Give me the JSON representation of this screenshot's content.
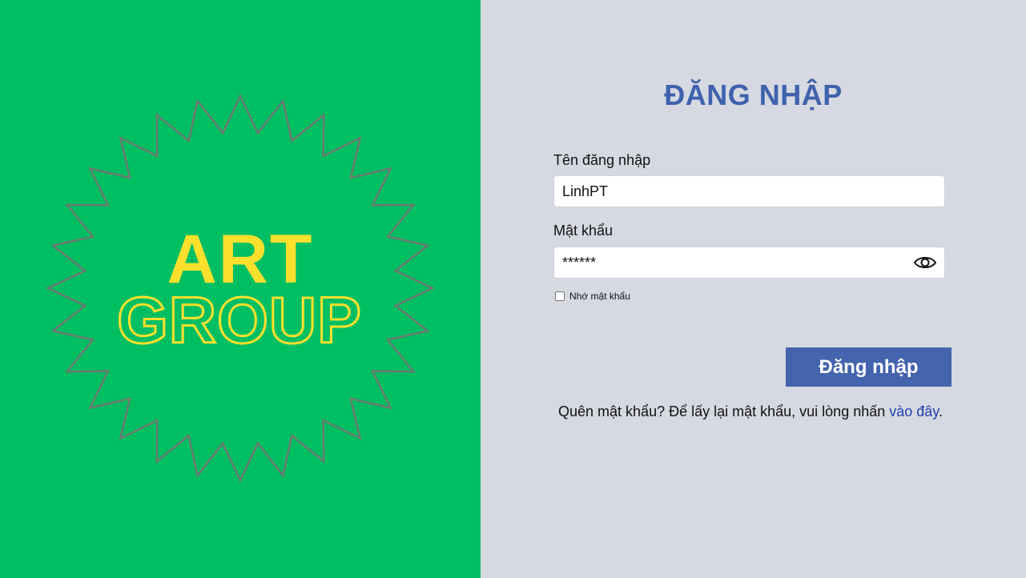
{
  "logo": {
    "line1": "ART",
    "line2": "GROUP",
    "colors": {
      "background": "#00bf62",
      "text": "#fde02c",
      "outline": "#6b7a70"
    }
  },
  "form": {
    "title": "ĐĂNG NHẬP",
    "username_label": "Tên đăng nhập",
    "username_value": "LinhPT",
    "password_label": "Mật khẩu",
    "password_value": "******",
    "remember_label": "Nhớ mật khẩu",
    "remember_checked": false,
    "submit_label": "Đăng nhập",
    "forgot_text": "Quên mật khẩu? Để lấy lại mật khẩu, vui lòng nhấn ",
    "forgot_link": "vào đây",
    "forgot_suffix": ".",
    "eye_icon": "eye-icon",
    "colors": {
      "title": "#3f62ad",
      "button": "#4564ae",
      "link": "#1d3fb0",
      "panel": "#d6d9e1"
    }
  }
}
